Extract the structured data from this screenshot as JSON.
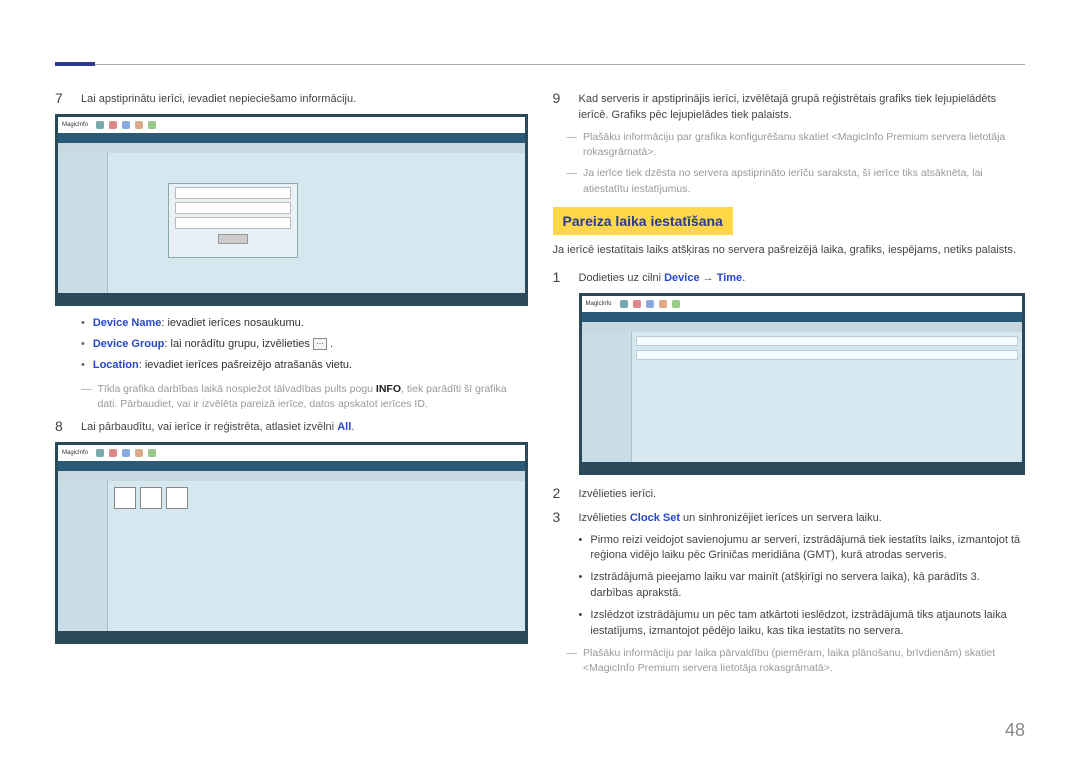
{
  "pageNumber": "48",
  "left": {
    "step7": {
      "num": "7",
      "text": "Lai apstiprinātu ierīci, ievadiet nepieciešamo informāciju."
    },
    "bullets": {
      "deviceName": {
        "label": "Device Name",
        "text": ": ievadiet ierīces nosaukumu."
      },
      "deviceGroup": {
        "label": "Device Group",
        "text": ": lai norādītu grupu, izvēlieties "
      },
      "location": {
        "label": "Location",
        "text": ": ievadiet ierīces pašreizējo atrašanās vietu."
      }
    },
    "note1a": "Tīkla grafika darbības laikā nospiežot tālvadības pults pogu ",
    "note1b": "INFO",
    "note1c": ", tiek parādīti šī grafika dati. Pārbaudiet, vai ir izvēlēta pareizā ierīce, datos apskatot ierīces ID.",
    "step8": {
      "num": "8",
      "textA": "Lai pārbaudītu, vai ierīce ir reģistrēta, atlasiet izvēlni ",
      "all": "All",
      "textB": "."
    }
  },
  "right": {
    "step9": {
      "num": "9",
      "text": "Kad serveris ir apstiprinājis ierīci, izvēlētajā grupā reģistrētais grafiks tiek lejupielādēts ierīcē. Grafiks pēc lejupielādes tiek palaists."
    },
    "note1": "Plašāku informāciju par grafika konfigurēšanu skatiet <MagicInfo Premium servera lietotāja rokasgrāmatā>.",
    "note2": "Ja ierīce tiek dzēsta no servera apstiprināto ierīču saraksta, šī ierīce tiks atsāknēta, lai atiestatītu iestatījumus.",
    "sectionTitle": "Pareiza laika iestatīšana",
    "sectionIntro": "Ja ierīcē iestatītais laiks atšķiras no servera pašreizējā laika, grafiks, iespējams, netiks palaists.",
    "step1": {
      "num": "1",
      "textA": "Dodieties uz cilni ",
      "device": "Device",
      "arrow": " → ",
      "time": "Time",
      "textB": "."
    },
    "step2": {
      "num": "2",
      "text": "Izvēlieties ierīci."
    },
    "step3": {
      "num": "3",
      "textA": "Izvēlieties ",
      "clockSet": "Clock Set",
      "textB": " un sinhronizējiet ierīces un servera laiku."
    },
    "subBullets": {
      "b1": "Pirmo reizi veidojot savienojumu ar serveri, izstrādājumā tiek iestatīts laiks, izmantojot tā reģiona vidējo laiku pēc Griničas meridiāna (GMT), kurā atrodas serveris.",
      "b2": "Izstrādājumā pieejamo laiku var mainīt (atšķirīgi no servera laika), kā parādīts 3. darbības aprakstā.",
      "b3": "Izslēdzot izstrādājumu un pēc tam atkārtoti ieslēdzot, izstrādājumā tiks atjaunots laika iestatījums, izmantojot pēdējo laiku, kas tika iestatīts no servera."
    },
    "note3": "Plašāku informāciju par laika pārvaldību (piemēram, laika plānošanu, brīvdienām) skatiet <MagicInfo Premium servera lietotāja rokasgrāmatā>.",
    "screenshotLogo": "MagicInfo"
  }
}
